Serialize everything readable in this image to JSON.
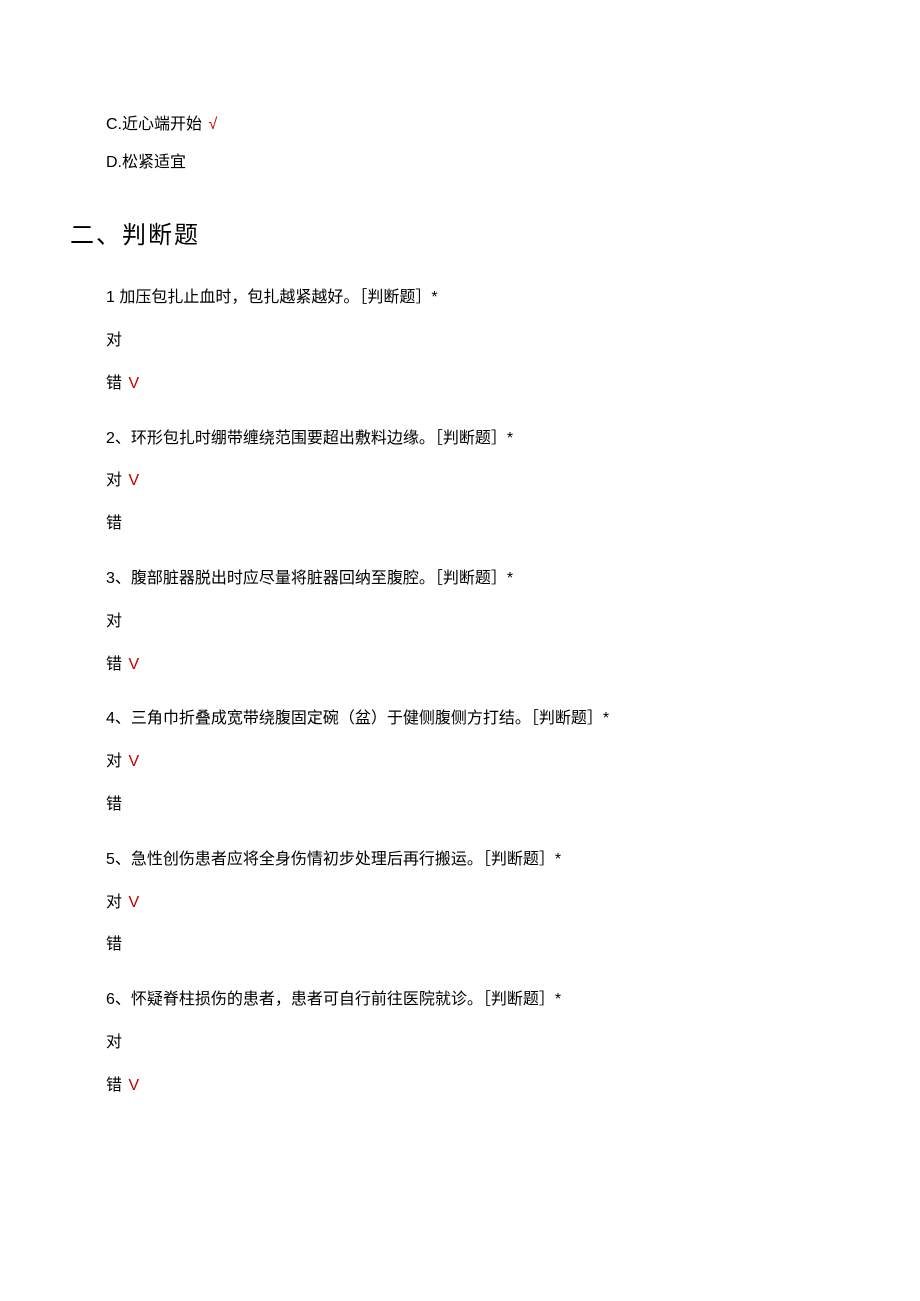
{
  "options_continued": [
    {
      "label": "C.近心端开始",
      "correct": true,
      "mark": "√"
    },
    {
      "label": "D.松紧适宜",
      "correct": false
    }
  ],
  "section2": {
    "heading": "二、判断题",
    "questions": [
      {
        "text": "1 加压包扎止血时，包扎越紧越好。［判断题］*",
        "choices": [
          {
            "label": "对",
            "correct": false
          },
          {
            "label": "错",
            "correct": true,
            "mark": "V"
          }
        ]
      },
      {
        "text": "2、环形包扎时绷带缠绕范围要超出敷料边缘。［判断题］*",
        "choices": [
          {
            "label": "对",
            "correct": true,
            "mark": "V"
          },
          {
            "label": "错",
            "correct": false
          }
        ]
      },
      {
        "text": "3、腹部脏器脱出时应尽量将脏器回纳至腹腔。［判断题］*",
        "choices": [
          {
            "label": "对",
            "correct": false
          },
          {
            "label": "错",
            "correct": true,
            "mark": "V"
          }
        ]
      },
      {
        "text": "4、三角巾折叠成宽带绕腹固定碗（盆）于健侧腹侧方打结。［判断题］*",
        "choices": [
          {
            "label": "对",
            "correct": true,
            "mark": "V"
          },
          {
            "label": "错",
            "correct": false
          }
        ]
      },
      {
        "text": "5、急性创伤患者应将全身伤情初步处理后再行搬运。［判断题］*",
        "choices": [
          {
            "label": "对",
            "correct": true,
            "mark": "V"
          },
          {
            "label": "错",
            "correct": false
          }
        ]
      },
      {
        "text": "6、怀疑脊柱损伤的患者，患者可自行前往医院就诊。［判断题］*",
        "choices": [
          {
            "label": "对",
            "correct": false
          },
          {
            "label": "错",
            "correct": true,
            "mark": "V"
          }
        ]
      }
    ]
  }
}
